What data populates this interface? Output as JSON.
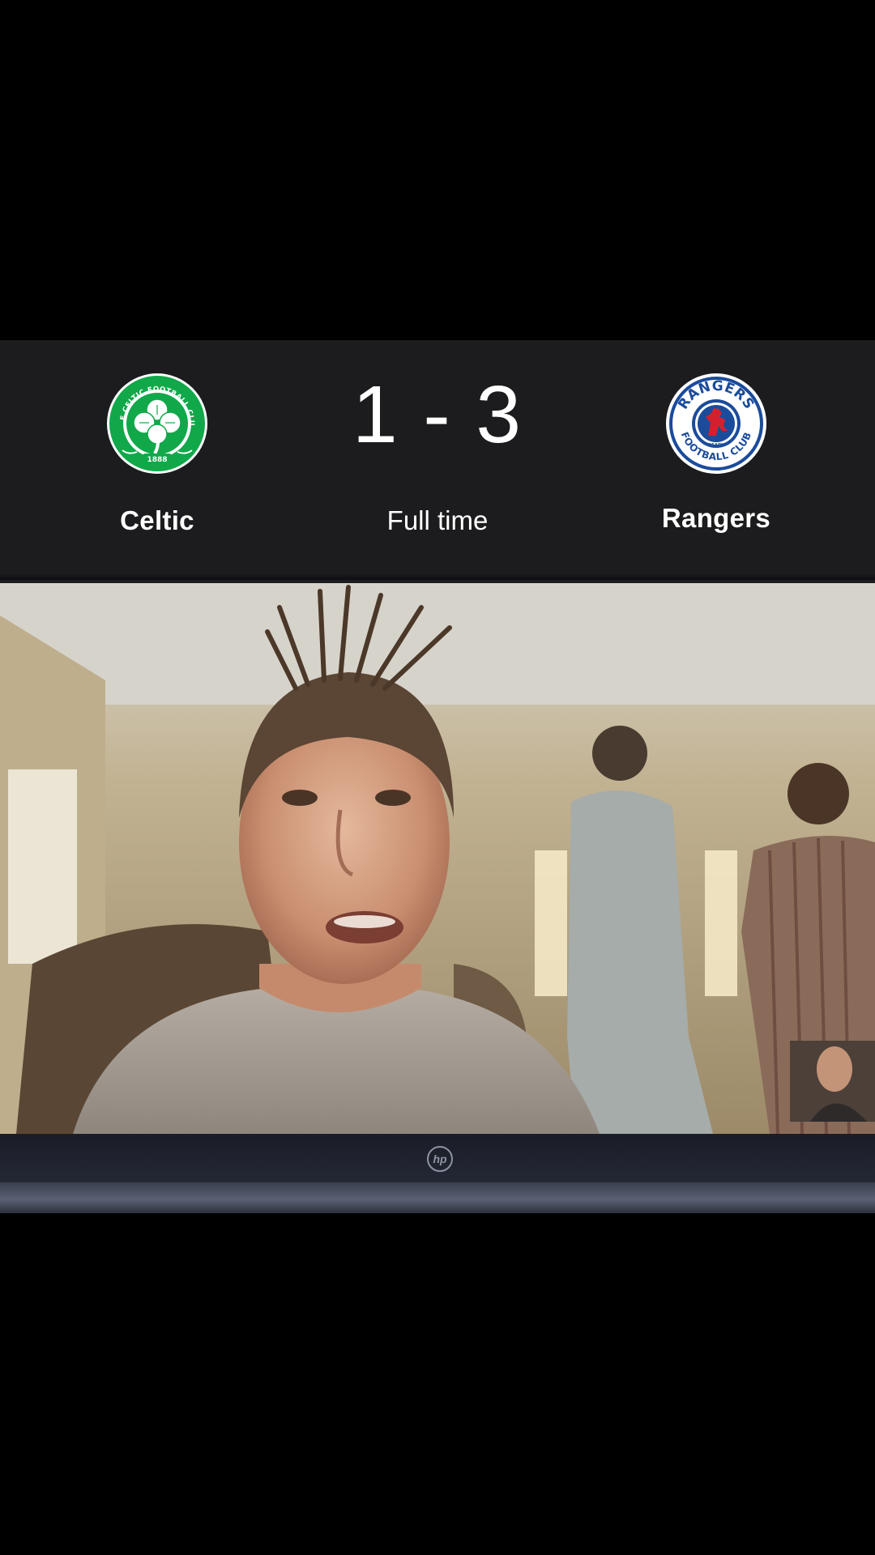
{
  "match": {
    "home_team": "Celtic",
    "away_team": "Rangers",
    "score": "1 - 3",
    "status": "Full time"
  },
  "crests": {
    "home": {
      "ring_text": "THE CELTIC FOOTBALL CLUB",
      "year": "1888",
      "color": "#11a84a"
    },
    "away": {
      "top_text": "RANGERS",
      "bottom_text": "FOOTBALL CLUB",
      "motto": "READY",
      "color": "#1b4b9b"
    }
  },
  "video": {
    "laptop_brand": "hp"
  },
  "colors": {
    "scoreboard_bg": "#1c1c1e",
    "text": "#ffffff",
    "celtic_green": "#11a84a",
    "rangers_blue": "#1b4b9b",
    "rangers_red": "#d3202f"
  }
}
